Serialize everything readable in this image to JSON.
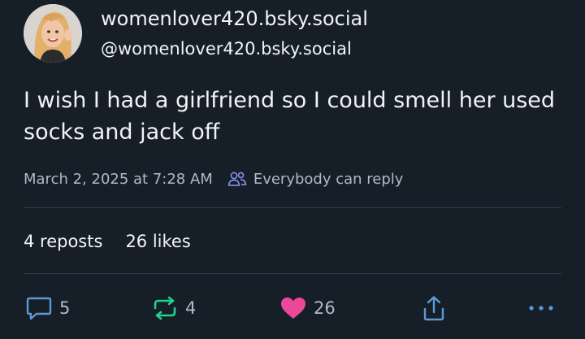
{
  "author": {
    "display_name": "womenlover420.bsky.social",
    "handle": "@womenlover420.bsky.social",
    "avatar_icon": "profile-photo"
  },
  "post": {
    "text": "I wish I had a girlfriend so I could smell her used socks and jack off",
    "timestamp": "March 2, 2025 at 7:28 AM",
    "reply_setting": "Everybody can reply"
  },
  "stats": {
    "reposts": "4 reposts",
    "likes": "26 likes"
  },
  "actions": {
    "reply_count": "5",
    "repost_count": "4",
    "like_count": "26"
  },
  "colors": {
    "background": "#161e27",
    "primary_text": "#f1f3f5",
    "secondary_text": "#aebbc9",
    "reply_setting_icon": "#7c8ce3",
    "repost_icon": "#1fd28a",
    "like_icon": "#ec4899",
    "reply_icon": "#5b9bd5",
    "share_icon": "#5b9bd5"
  }
}
